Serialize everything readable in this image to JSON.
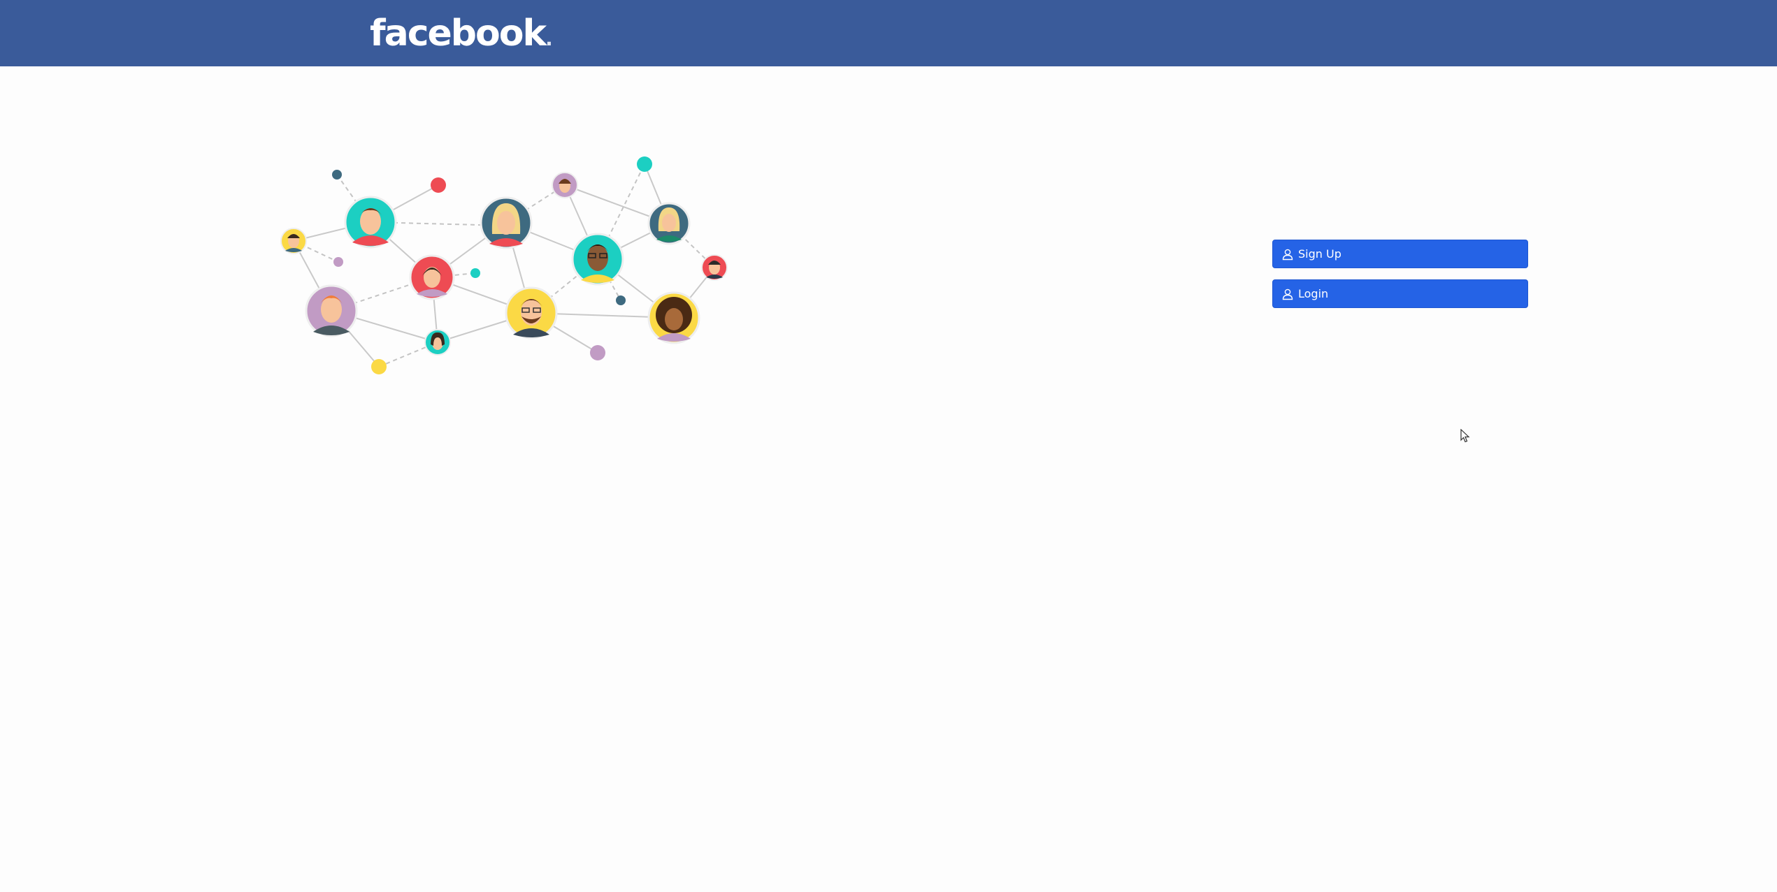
{
  "header": {
    "logo_text": "facebook",
    "logo_dot": ".",
    "background_color": "#3a5b9a"
  },
  "illustration": {
    "description_icon": "people-network-illustration"
  },
  "auth": {
    "signup_label": "Sign Up",
    "login_label": "Login",
    "signup_icon": "user-icon",
    "login_icon": "user-icon",
    "button_color": "#2563e6"
  },
  "pointer": {
    "icon": "mouse-cursor-icon"
  }
}
